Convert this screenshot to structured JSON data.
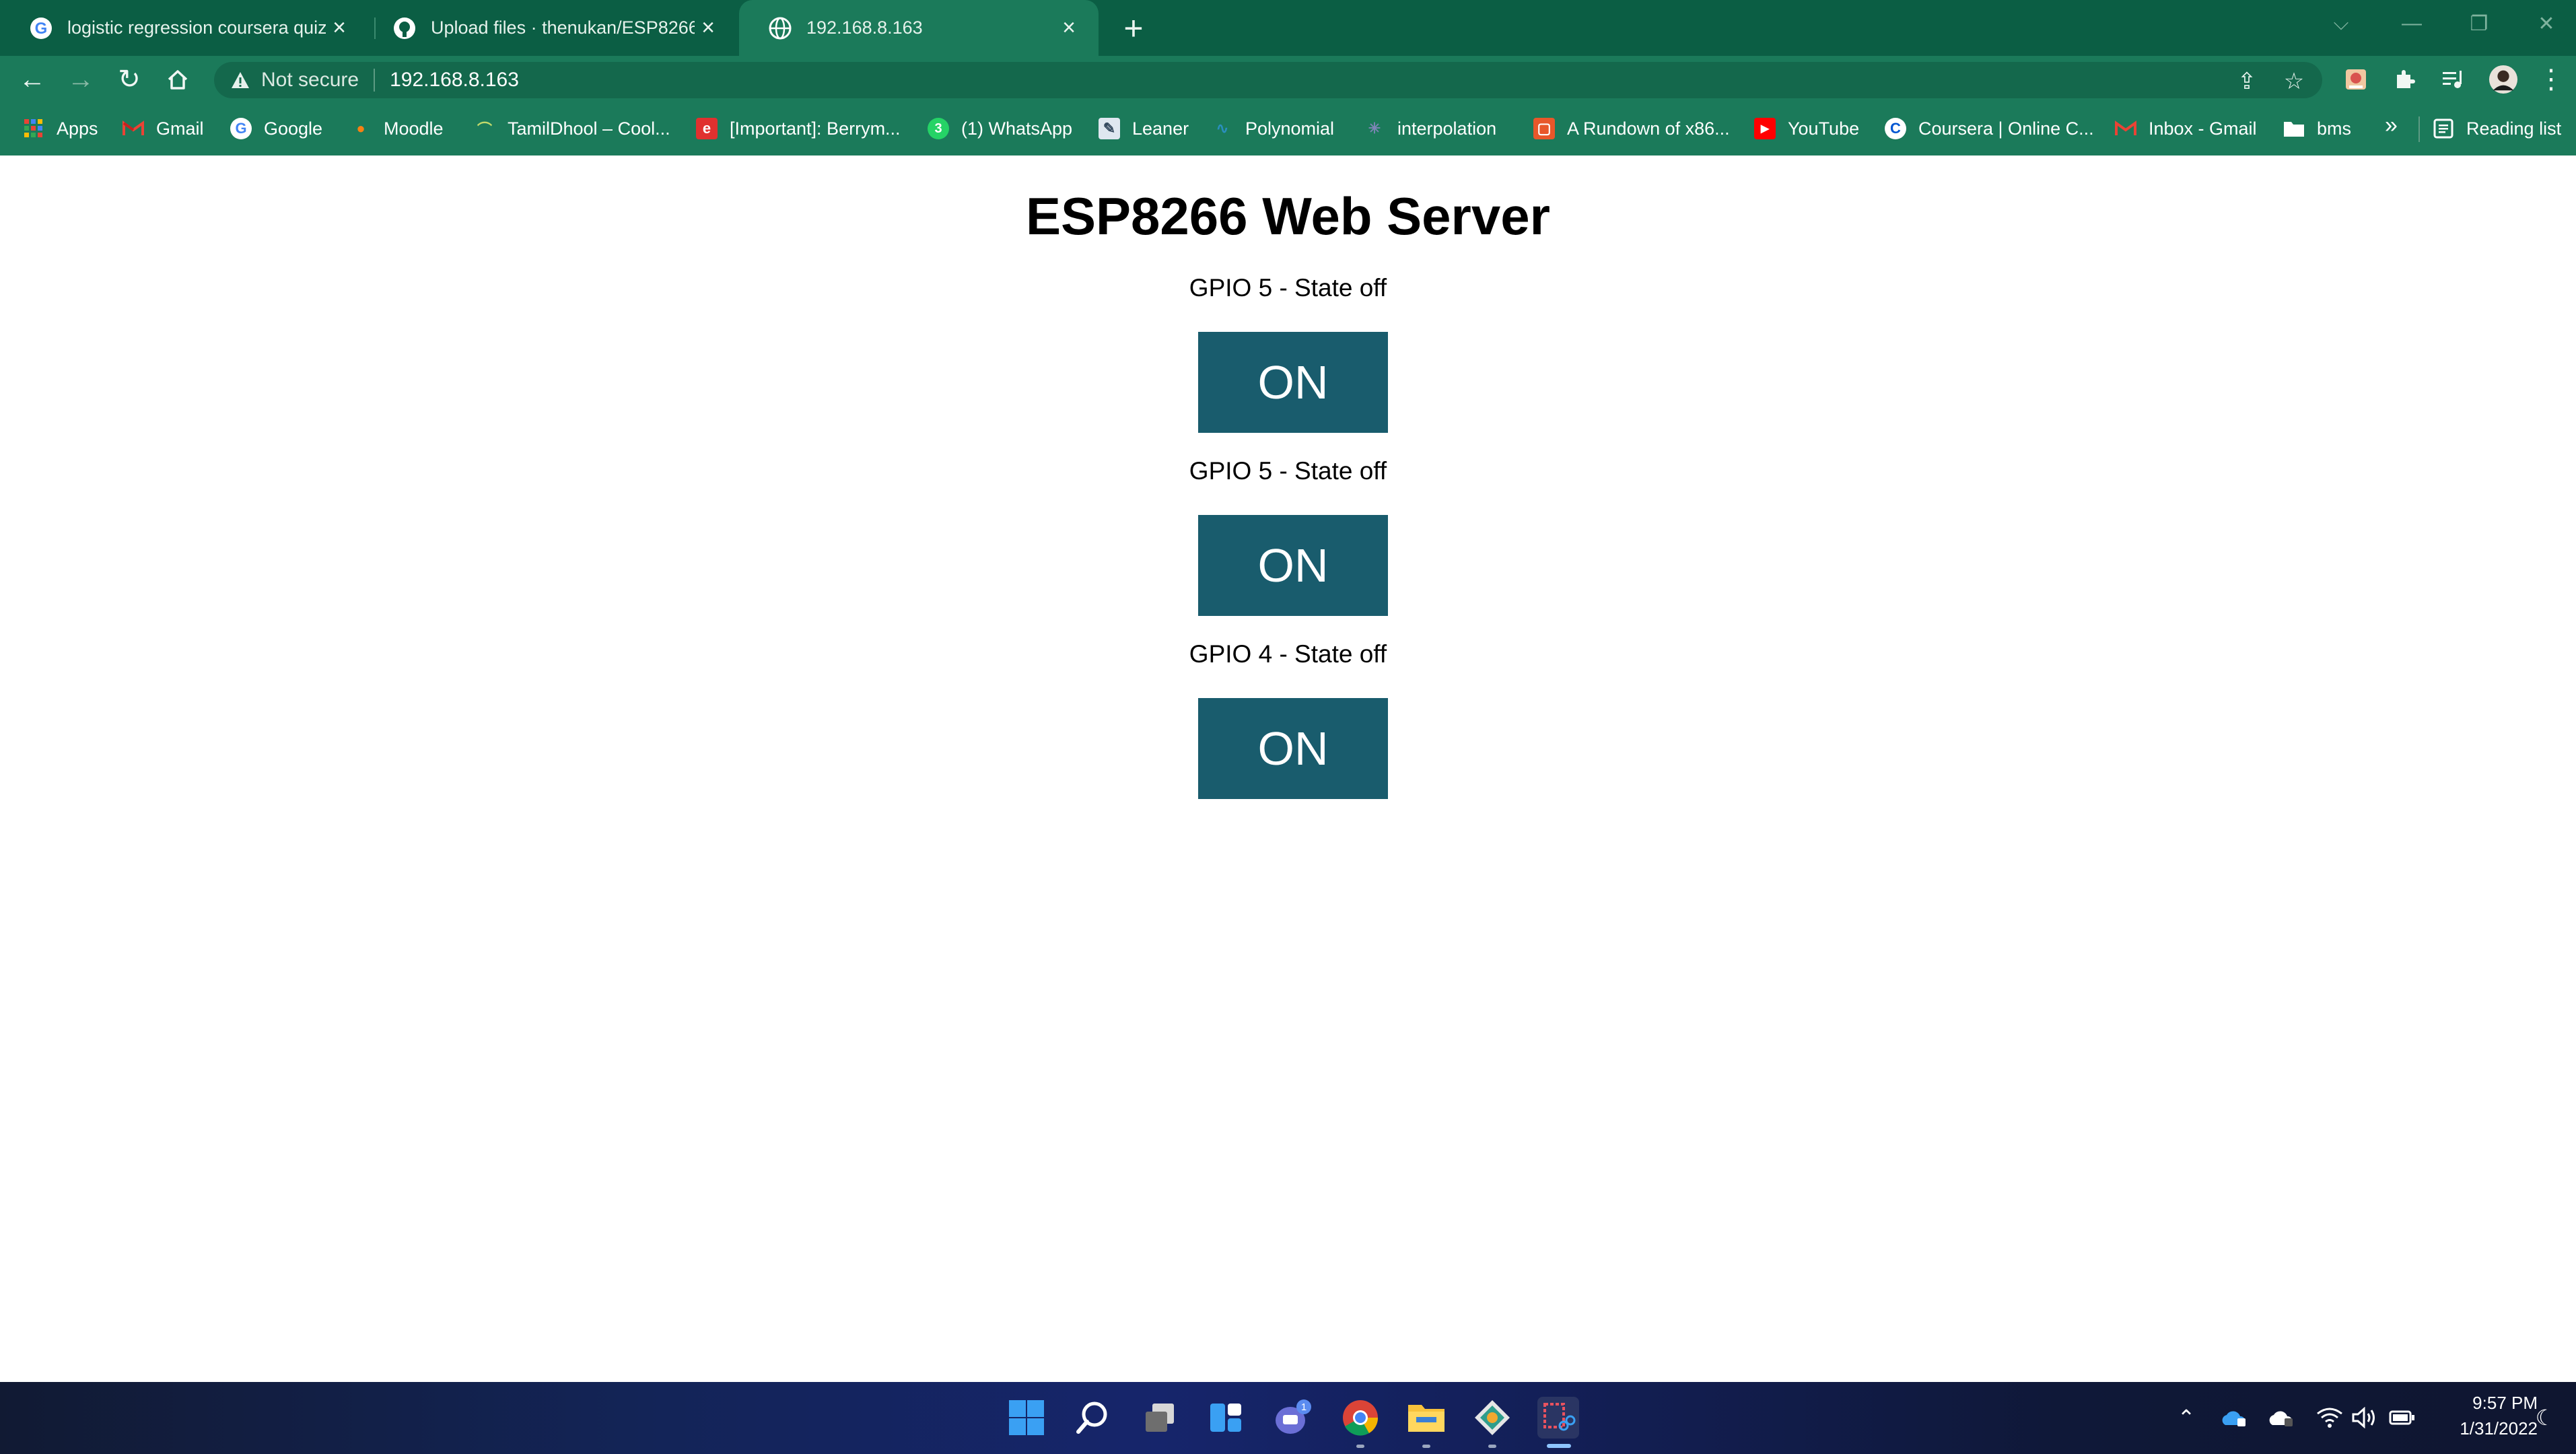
{
  "browser": {
    "tabs": [
      {
        "title": "logistic regression coursera quiz",
        "icon": "google-g-icon",
        "active": false
      },
      {
        "title": "Upload files · thenukan/ESP8266",
        "icon": "github-icon",
        "active": false
      },
      {
        "title": "192.168.8.163",
        "icon": "globe-icon",
        "active": true
      }
    ],
    "address": {
      "security_label": "Not secure",
      "url": "192.168.8.163"
    },
    "bookmarks": [
      {
        "label": "Apps",
        "icon": "apps-grid-icon"
      },
      {
        "label": "Gmail",
        "icon": "gmail-icon"
      },
      {
        "label": "Google",
        "icon": "google-g-icon"
      },
      {
        "label": "Moodle",
        "icon": "moodle-icon"
      },
      {
        "label": "TamilDhool – Cool...",
        "icon": "tamildhool-icon"
      },
      {
        "label": "[Important]: Berrym...",
        "icon": "e-icon"
      },
      {
        "label": "(1) WhatsApp",
        "icon": "whatsapp-icon"
      },
      {
        "label": "Leaner",
        "icon": "leaner-icon"
      },
      {
        "label": "Polynomial",
        "icon": "polynomial-icon"
      },
      {
        "label": "interpolation",
        "icon": "interpolation-icon"
      },
      {
        "label": "A Rundown of x86...",
        "icon": "rundown-icon"
      },
      {
        "label": "YouTube",
        "icon": "youtube-icon"
      },
      {
        "label": "Coursera | Online C...",
        "icon": "coursera-icon"
      },
      {
        "label": "Inbox - Gmail",
        "icon": "gmail-icon"
      },
      {
        "label": "bms",
        "icon": "folder-icon"
      }
    ],
    "overflow_label": "»",
    "reading_list_label": "Reading list"
  },
  "page": {
    "heading": "ESP8266 Web Server",
    "gpios": [
      {
        "label": "GPIO 5 - State off",
        "button_label": "ON"
      },
      {
        "label": "GPIO 5 - State off",
        "button_label": "ON"
      },
      {
        "label": "GPIO 4 - State off",
        "button_label": "ON"
      }
    ]
  },
  "taskbar": {
    "time": "9:57 PM",
    "date": "1/31/2022",
    "teams_badge": "1"
  },
  "colors": {
    "chrome_dark": "#0b5e44",
    "chrome_light": "#1b7a5a",
    "button_bg": "#195c6d"
  }
}
